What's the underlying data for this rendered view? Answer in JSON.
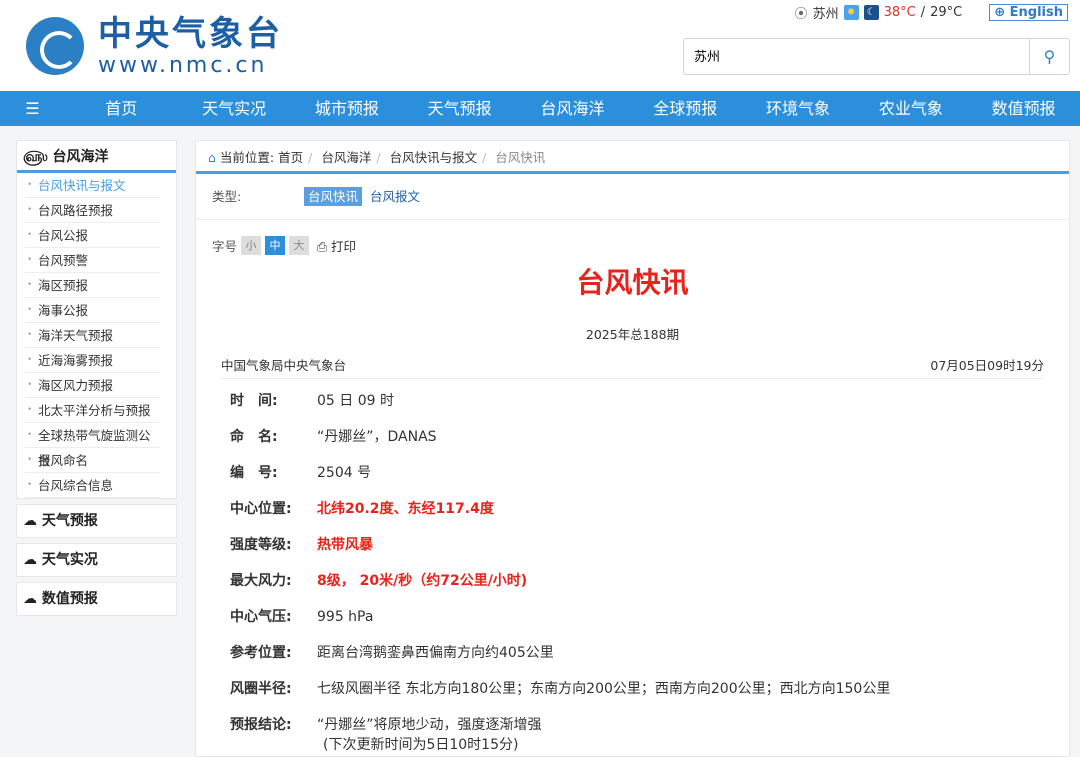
{
  "header": {
    "logo_cn": "中央气象台",
    "logo_en": "www.nmc.cn",
    "city": "苏州",
    "temp_high": "38°C",
    "temp_sep": "/",
    "temp_low": "29°C",
    "english": "English",
    "search_value": "苏州"
  },
  "nav": [
    "首页",
    "天气实况",
    "城市预报",
    "天气预报",
    "台风海洋",
    "全球预报",
    "环境气象",
    "农业气象",
    "数值预报"
  ],
  "sidebar": {
    "title": "台风海洋",
    "items": [
      "台风快讯与报文",
      "台风路径预报",
      "台风公报",
      "台风预警",
      "海区预报",
      "海事公报",
      "海洋天气预报",
      "近海海雾预报",
      "海区风力预报",
      "北太平洋分析与预报",
      "全球热带气旋监测公报",
      "台风命名",
      "台风综合信息"
    ],
    "sections": [
      "天气预报",
      "天气实况",
      "数值预报"
    ]
  },
  "breadcrumb": {
    "label": "当前位置:",
    "items": [
      "首页",
      "台风海洋",
      "台风快讯与报文",
      "台风快讯"
    ]
  },
  "type": {
    "label": "类型:",
    "tabs": [
      "台风快讯",
      "台风报文"
    ]
  },
  "font": {
    "label": "字号",
    "small": "小",
    "medium": "中",
    "large": "大",
    "print": "打印"
  },
  "article": {
    "title": "台风快讯",
    "issue": "2025年总188期",
    "source": "中国气象局中央气象台",
    "time": "07月05日09时19分",
    "rows": [
      {
        "label": "时　间:",
        "value": "05 日 09 时",
        "red": false
      },
      {
        "label": "命　名:",
        "value": "“丹娜丝”，DANAS",
        "red": false
      },
      {
        "label": "编　号:",
        "value": "2504 号",
        "red": false
      },
      {
        "label": "中心位置:",
        "value": "北纬20.2度、东经117.4度",
        "red": true
      },
      {
        "label": "强度等级:",
        "value": "热带风暴",
        "red": true
      },
      {
        "label": "最大风力:",
        "value": "8级， 20米/秒（约72公里/小时)",
        "red": true
      },
      {
        "label": "中心气压:",
        "value": "995 hPa",
        "red": false
      },
      {
        "label": "参考位置:",
        "value": "距离台湾鹅銮鼻西偏南方向约405公里",
        "red": false
      },
      {
        "label": "风圈半径:",
        "value": "七级风圈半径 东北方向180公里；东南方向200公里；西南方向200公里；西北方向150公里",
        "red": false
      },
      {
        "label": "预报结论:",
        "value": "“丹娜丝”将原地少动，强度逐渐增强",
        "red": false
      }
    ],
    "next_update": "(下次更新时间为5日10时15分)"
  }
}
